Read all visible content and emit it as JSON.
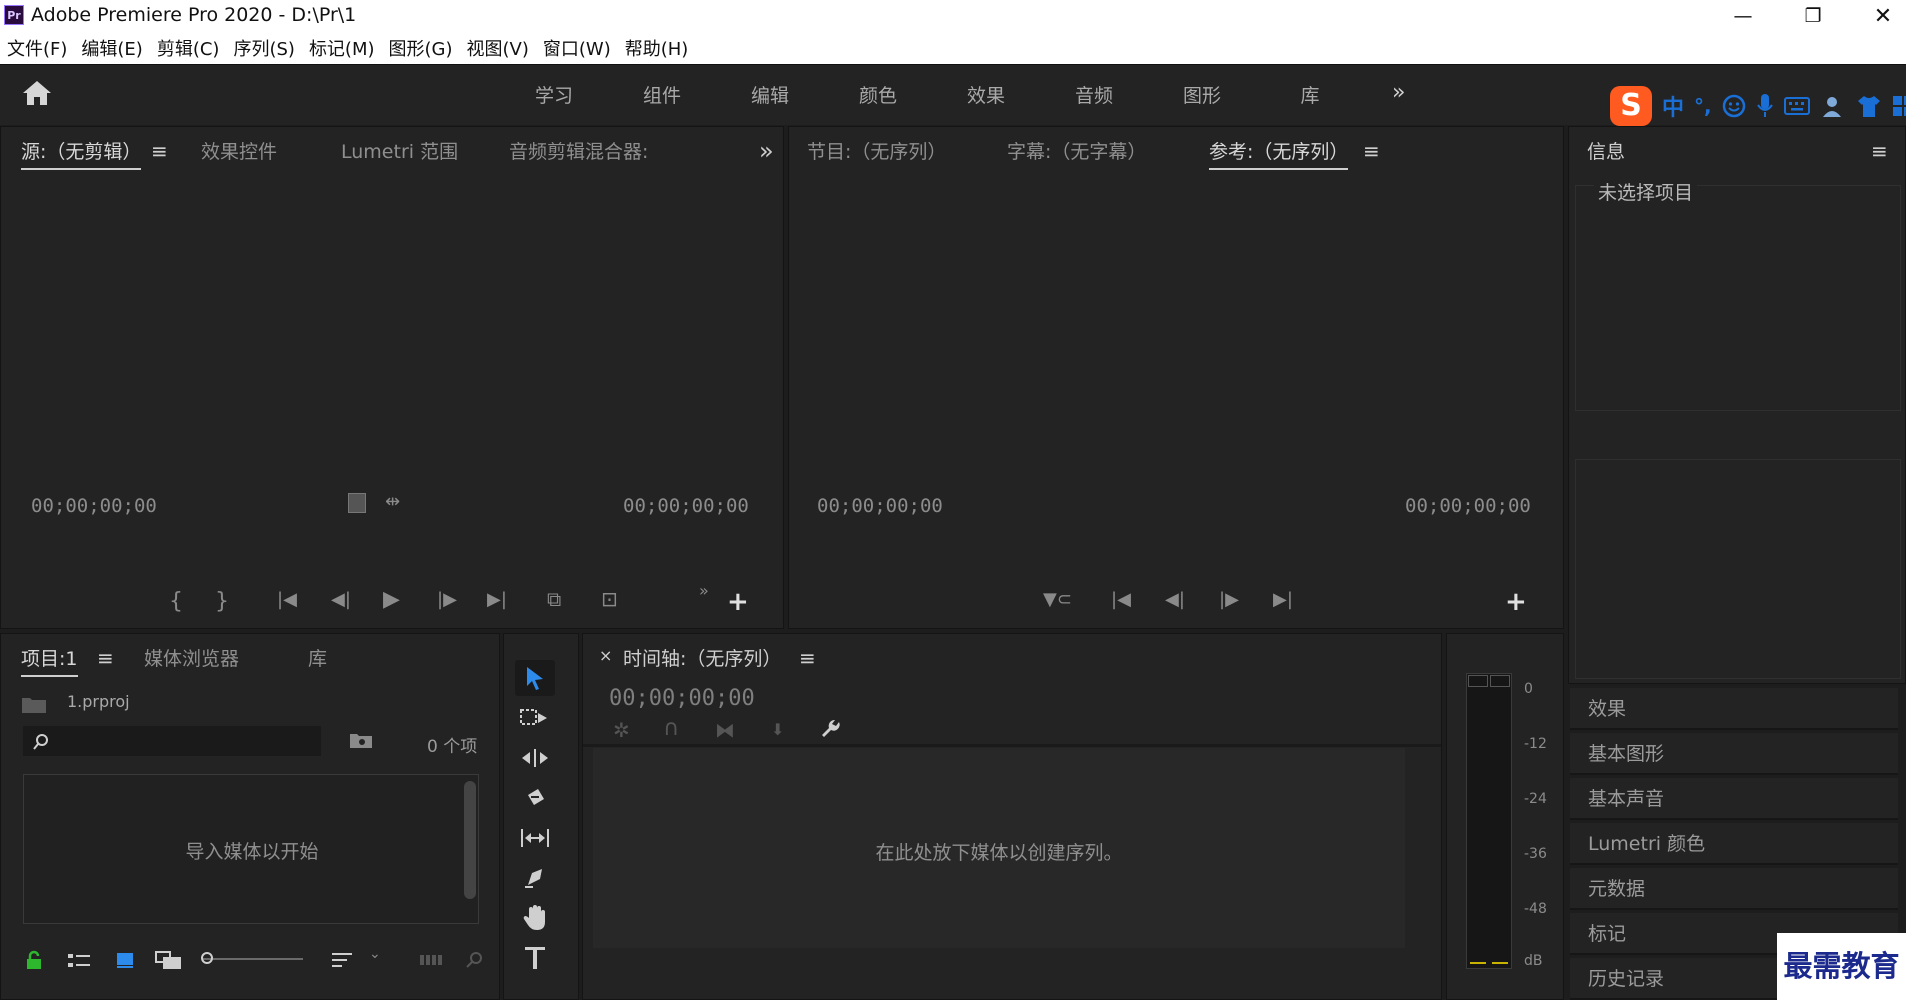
{
  "window": {
    "app_logo": "Pr",
    "title": "Adobe Premiere Pro 2020 - D:\\Pr\\1",
    "minimize_glyph": "—",
    "restore_glyph": "❐",
    "close_glyph": "✕"
  },
  "menu": [
    "文件(F)",
    "编辑(E)",
    "剪辑(C)",
    "序列(S)",
    "标记(M)",
    "图形(G)",
    "视图(V)",
    "窗口(W)",
    "帮助(H)"
  ],
  "workspaces": {
    "tabs": [
      "学习",
      "组件",
      "编辑",
      "颜色",
      "效果",
      "音频",
      "图形",
      "库"
    ],
    "more": "»"
  },
  "ime": {
    "mode": "中",
    "punct": "°,"
  },
  "source_panel": {
    "tabs": [
      "源:（无剪辑）",
      "效果控件",
      "Lumetri 范围",
      "音频剪辑混合器:"
    ],
    "menu": "≡",
    "more": "»",
    "timecode_left": "00;00;00;00",
    "timecode_right": "00;00;00;00"
  },
  "program_panel": {
    "tabs": [
      "节目:（无序列）",
      "字幕:（无字幕）",
      "参考:（无序列）"
    ],
    "menu": "≡",
    "timecode_left": "00;00;00;00",
    "timecode_right": "00;00;00;00"
  },
  "info_panel": {
    "title": "信息",
    "menu": "≡",
    "message": "未选择项目"
  },
  "side_panels": [
    "效果",
    "基本图形",
    "基本声音",
    "Lumetri 颜色",
    "元数据",
    "标记",
    "历史记录"
  ],
  "project_panel": {
    "tabs": [
      "项目:1",
      "媒体浏览器",
      "库"
    ],
    "menu": "≡",
    "filename": "1.prproj",
    "search_placeholder": "",
    "item_count": "0 个项",
    "import_hint": "导入媒体以开始"
  },
  "timeline_panel": {
    "close": "×",
    "title": "时间轴:（无序列）",
    "menu": "≡",
    "timecode": "00;00;00;00",
    "drop_hint": "在此处放下媒体以创建序列。"
  },
  "audio_meter": {
    "labels": [
      "0",
      "-12",
      "-24",
      "-36",
      "-48",
      "dB"
    ]
  },
  "plus": "+",
  "watermark": "最需教育",
  "colors": {
    "accent": "#2d8ceb",
    "lock": "#2eb82e",
    "ime_brand": "#ff5a1f"
  }
}
